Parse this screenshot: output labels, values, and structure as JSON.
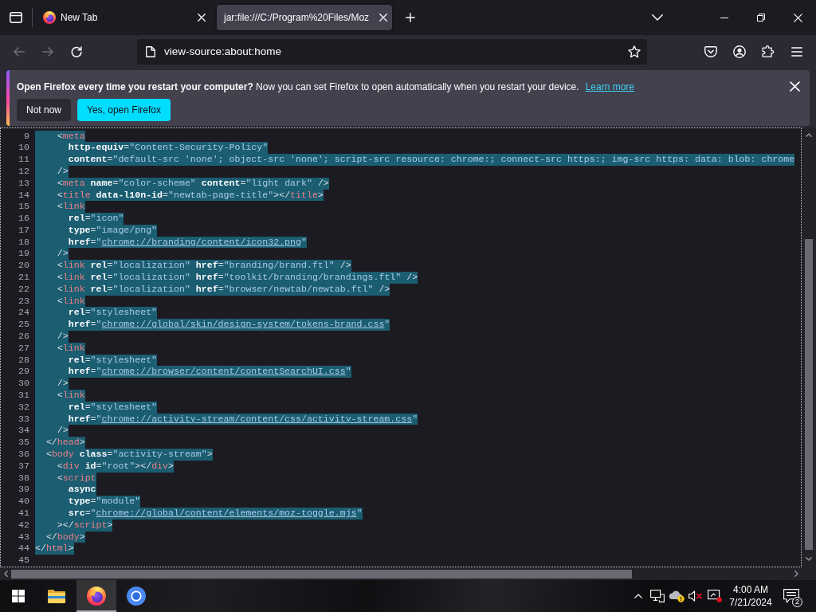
{
  "tab_bar": {
    "tabs": [
      {
        "title": "New Tab",
        "selected": false,
        "favicon": true
      },
      {
        "title": "jar:file:///C:/Program%20Files/Moz",
        "selected": true,
        "favicon": false
      }
    ]
  },
  "toolbar": {
    "nav_buttons": [
      {
        "kind": "back",
        "disabled": true
      },
      {
        "kind": "forward",
        "disabled": true
      },
      {
        "kind": "reload",
        "disabled": false
      }
    ],
    "url": "view-source:about:home"
  },
  "notification": {
    "message": "**Open Firefox every time you restart your computer?** Now you can set Firefox to open automatically when you restart your device.",
    "link": "Learn more",
    "buttons": [
      {
        "label": "Not now",
        "primary": false
      },
      {
        "label": "Yes, open Firefox",
        "primary": true
      }
    ]
  },
  "code": {
    "lines": [
      {
        "number": "9",
        "selected": true,
        "tokens": [
          {
            "kind": "punct",
            "text": "    <"
          },
          {
            "kind": "tag",
            "text": "meta"
          }
        ]
      },
      {
        "number": "10",
        "selected": true,
        "tokens": [
          {
            "kind": "attr",
            "text": "      http-equiv"
          },
          {
            "kind": "punct",
            "text": "="
          },
          {
            "kind": "value",
            "text": "\"Content-Security-Policy\""
          }
        ]
      },
      {
        "number": "11",
        "selected": true,
        "tokens": [
          {
            "kind": "attr",
            "text": "      content"
          },
          {
            "kind": "punct",
            "text": "="
          },
          {
            "kind": "value",
            "text": "\"default-src 'none'; object-src 'none'; script-src resource: chrome:; connect-src https:; img-src https: data: blob: chrome"
          }
        ]
      },
      {
        "number": "12",
        "selected": true,
        "tokens": [
          {
            "kind": "punct",
            "text": "    />"
          }
        ]
      },
      {
        "number": "13",
        "selected": true,
        "tokens": [
          {
            "kind": "punct",
            "text": "    <"
          },
          {
            "kind": "tag",
            "text": "meta"
          },
          {
            "kind": "attr",
            "text": " name"
          },
          {
            "kind": "punct",
            "text": "="
          },
          {
            "kind": "value",
            "text": "\"color-scheme\""
          },
          {
            "kind": "attr",
            "text": " content"
          },
          {
            "kind": "punct",
            "text": "="
          },
          {
            "kind": "value",
            "text": "\"light dark\""
          },
          {
            "kind": "punct",
            "text": " />"
          }
        ]
      },
      {
        "number": "14",
        "selected": true,
        "tokens": [
          {
            "kind": "punct",
            "text": "    <"
          },
          {
            "kind": "tag",
            "text": "title"
          },
          {
            "kind": "attr",
            "text": " data-l10n-id"
          },
          {
            "kind": "punct",
            "text": "="
          },
          {
            "kind": "value",
            "text": "\"newtab-page-title\""
          },
          {
            "kind": "punct",
            "text": "></"
          },
          {
            "kind": "tag",
            "text": "title"
          },
          {
            "kind": "punct",
            "text": ">"
          }
        ]
      },
      {
        "number": "15",
        "selected": true,
        "tokens": [
          {
            "kind": "punct",
            "text": "    <"
          },
          {
            "kind": "tag",
            "text": "link"
          }
        ]
      },
      {
        "number": "16",
        "selected": true,
        "tokens": [
          {
            "kind": "attr",
            "text": "      rel"
          },
          {
            "kind": "punct",
            "text": "="
          },
          {
            "kind": "value",
            "text": "\"icon\""
          }
        ]
      },
      {
        "number": "17",
        "selected": true,
        "tokens": [
          {
            "kind": "attr",
            "text": "      type"
          },
          {
            "kind": "punct",
            "text": "="
          },
          {
            "kind": "value",
            "text": "\"image/png\""
          }
        ]
      },
      {
        "number": "18",
        "selected": true,
        "tokens": [
          {
            "kind": "attr",
            "text": "      href"
          },
          {
            "kind": "punct",
            "text": "="
          },
          {
            "kind": "value",
            "text": "\""
          },
          {
            "kind": "link",
            "text": "chrome://branding/content/icon32.png"
          },
          {
            "kind": "value",
            "text": "\""
          }
        ]
      },
      {
        "number": "19",
        "selected": true,
        "tokens": [
          {
            "kind": "punct",
            "text": "    />"
          }
        ]
      },
      {
        "number": "20",
        "selected": true,
        "tokens": [
          {
            "kind": "punct",
            "text": "    <"
          },
          {
            "kind": "tag",
            "text": "link"
          },
          {
            "kind": "attr",
            "text": " rel"
          },
          {
            "kind": "punct",
            "text": "="
          },
          {
            "kind": "value",
            "text": "\"localization\""
          },
          {
            "kind": "attr",
            "text": " href"
          },
          {
            "kind": "punct",
            "text": "="
          },
          {
            "kind": "value",
            "text": "\"branding/brand.ftl\""
          },
          {
            "kind": "punct",
            "text": " />"
          }
        ]
      },
      {
        "number": "21",
        "selected": true,
        "tokens": [
          {
            "kind": "punct",
            "text": "    <"
          },
          {
            "kind": "tag",
            "text": "link"
          },
          {
            "kind": "attr",
            "text": " rel"
          },
          {
            "kind": "punct",
            "text": "="
          },
          {
            "kind": "value",
            "text": "\"localization\""
          },
          {
            "kind": "attr",
            "text": " href"
          },
          {
            "kind": "punct",
            "text": "="
          },
          {
            "kind": "value",
            "text": "\"toolkit/branding/brandings.ftl\""
          },
          {
            "kind": "punct",
            "text": " />"
          }
        ]
      },
      {
        "number": "22",
        "selected": true,
        "tokens": [
          {
            "kind": "punct",
            "text": "    <"
          },
          {
            "kind": "tag",
            "text": "link"
          },
          {
            "kind": "attr",
            "text": " rel"
          },
          {
            "kind": "punct",
            "text": "="
          },
          {
            "kind": "value",
            "text": "\"localization\""
          },
          {
            "kind": "attr",
            "text": " href"
          },
          {
            "kind": "punct",
            "text": "="
          },
          {
            "kind": "value",
            "text": "\"browser/newtab/newtab.ftl\""
          },
          {
            "kind": "punct",
            "text": " />"
          }
        ]
      },
      {
        "number": "23",
        "selected": true,
        "tokens": [
          {
            "kind": "punct",
            "text": "    <"
          },
          {
            "kind": "tag",
            "text": "link"
          }
        ]
      },
      {
        "number": "24",
        "selected": true,
        "tokens": [
          {
            "kind": "attr",
            "text": "      rel"
          },
          {
            "kind": "punct",
            "text": "="
          },
          {
            "kind": "value",
            "text": "\"stylesheet\""
          }
        ]
      },
      {
        "number": "25",
        "selected": true,
        "tokens": [
          {
            "kind": "attr",
            "text": "      href"
          },
          {
            "kind": "punct",
            "text": "="
          },
          {
            "kind": "value",
            "text": "\""
          },
          {
            "kind": "link",
            "text": "chrome://global/skin/design-system/tokens-brand.css"
          },
          {
            "kind": "value",
            "text": "\""
          }
        ]
      },
      {
        "number": "26",
        "selected": true,
        "tokens": [
          {
            "kind": "punct",
            "text": "    />"
          }
        ]
      },
      {
        "number": "27",
        "selected": true,
        "tokens": [
          {
            "kind": "punct",
            "text": "    <"
          },
          {
            "kind": "tag",
            "text": "link"
          }
        ]
      },
      {
        "number": "28",
        "selected": true,
        "tokens": [
          {
            "kind": "attr",
            "text": "      rel"
          },
          {
            "kind": "punct",
            "text": "="
          },
          {
            "kind": "value",
            "text": "\"stylesheet\""
          }
        ]
      },
      {
        "number": "29",
        "selected": true,
        "tokens": [
          {
            "kind": "attr",
            "text": "      href"
          },
          {
            "kind": "punct",
            "text": "="
          },
          {
            "kind": "value",
            "text": "\""
          },
          {
            "kind": "link",
            "text": "chrome://browser/content/contentSearchUI.css"
          },
          {
            "kind": "value",
            "text": "\""
          }
        ]
      },
      {
        "number": "30",
        "selected": true,
        "tokens": [
          {
            "kind": "punct",
            "text": "    />"
          }
        ]
      },
      {
        "number": "31",
        "selected": true,
        "tokens": [
          {
            "kind": "punct",
            "text": "    <"
          },
          {
            "kind": "tag",
            "text": "link"
          }
        ]
      },
      {
        "number": "32",
        "selected": true,
        "tokens": [
          {
            "kind": "attr",
            "text": "      rel"
          },
          {
            "kind": "punct",
            "text": "="
          },
          {
            "kind": "value",
            "text": "\"stylesheet\""
          }
        ]
      },
      {
        "number": "33",
        "selected": true,
        "tokens": [
          {
            "kind": "attr",
            "text": "      href"
          },
          {
            "kind": "punct",
            "text": "="
          },
          {
            "kind": "value",
            "text": "\""
          },
          {
            "kind": "link",
            "text": "chrome://activity-stream/content/css/activity-stream.css"
          },
          {
            "kind": "value",
            "text": "\""
          }
        ]
      },
      {
        "number": "34",
        "selected": true,
        "tokens": [
          {
            "kind": "punct",
            "text": "    />"
          }
        ]
      },
      {
        "number": "35",
        "selected": true,
        "tokens": [
          {
            "kind": "punct",
            "text": "  </"
          },
          {
            "kind": "tag",
            "text": "head"
          },
          {
            "kind": "punct",
            "text": ">"
          }
        ]
      },
      {
        "number": "36",
        "selected": true,
        "tokens": [
          {
            "kind": "punct",
            "text": "  <"
          },
          {
            "kind": "tag",
            "text": "body"
          },
          {
            "kind": "attr",
            "text": " class"
          },
          {
            "kind": "punct",
            "text": "="
          },
          {
            "kind": "value",
            "text": "\"activity-stream\""
          },
          {
            "kind": "punct",
            "text": ">"
          }
        ]
      },
      {
        "number": "37",
        "selected": true,
        "tokens": [
          {
            "kind": "punct",
            "text": "    <"
          },
          {
            "kind": "tag",
            "text": "div"
          },
          {
            "kind": "attr",
            "text": " id"
          },
          {
            "kind": "punct",
            "text": "="
          },
          {
            "kind": "value",
            "text": "\"root\""
          },
          {
            "kind": "punct",
            "text": "></"
          },
          {
            "kind": "tag",
            "text": "div"
          },
          {
            "kind": "punct",
            "text": ">"
          }
        ]
      },
      {
        "number": "38",
        "selected": true,
        "tokens": [
          {
            "kind": "punct",
            "text": "    <"
          },
          {
            "kind": "tag",
            "text": "script"
          }
        ]
      },
      {
        "number": "39",
        "selected": true,
        "tokens": [
          {
            "kind": "attr",
            "text": "      async"
          }
        ]
      },
      {
        "number": "40",
        "selected": true,
        "tokens": [
          {
            "kind": "attr",
            "text": "      type"
          },
          {
            "kind": "punct",
            "text": "="
          },
          {
            "kind": "value",
            "text": "\"module\""
          }
        ]
      },
      {
        "number": "41",
        "selected": true,
        "tokens": [
          {
            "kind": "attr",
            "text": "      src"
          },
          {
            "kind": "punct",
            "text": "="
          },
          {
            "kind": "value",
            "text": "\""
          },
          {
            "kind": "link",
            "text": "chrome://global/content/elements/moz-toggle.mjs"
          },
          {
            "kind": "value",
            "text": "\""
          }
        ]
      },
      {
        "number": "42",
        "selected": true,
        "tokens": [
          {
            "kind": "punct",
            "text": "    ></"
          },
          {
            "kind": "tag",
            "text": "script"
          },
          {
            "kind": "punct",
            "text": ">"
          }
        ]
      },
      {
        "number": "43",
        "selected": true,
        "tokens": [
          {
            "kind": "punct",
            "text": "  </"
          },
          {
            "kind": "tag",
            "text": "body"
          },
          {
            "kind": "punct",
            "text": ">"
          }
        ]
      },
      {
        "number": "44",
        "selected": true,
        "tokens": [
          {
            "kind": "punct",
            "text": "</"
          },
          {
            "kind": "tag",
            "text": "html"
          },
          {
            "kind": "punct",
            "text": ">"
          }
        ]
      },
      {
        "number": "45",
        "selected": false
      }
    ]
  },
  "taskbar": {
    "apps": [
      {
        "kind": "files",
        "active": false
      },
      {
        "kind": "fox",
        "active": true
      },
      {
        "kind": "ring",
        "active": false
      }
    ],
    "time": "4:00 AM",
    "date": "7/21/2024",
    "notification_count": "2"
  }
}
